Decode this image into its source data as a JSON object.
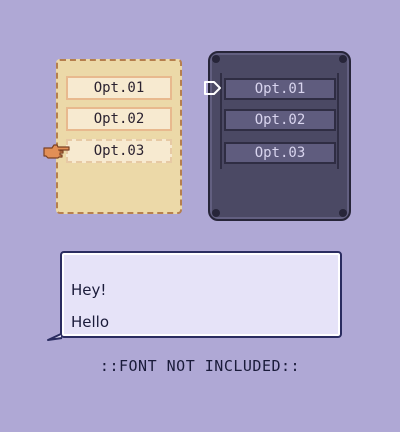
{
  "light_menu": {
    "options": [
      "Opt.01",
      "Opt.02",
      "Opt.03"
    ],
    "selected_index": 2,
    "colors": {
      "panel": "#ecd9a8",
      "border": "#b67f4d",
      "option_bg": "#f7ead0"
    },
    "cursor_icon": "pointing-hand-icon"
  },
  "dark_menu": {
    "options": [
      "Opt.01",
      "Opt.02",
      "Opt.03"
    ],
    "selected_index": 0,
    "colors": {
      "panel": "#4b4964",
      "border": "#272539",
      "option_bg": "#5f5c7e"
    },
    "cursor_icon": "outline-arrow-icon"
  },
  "dialog": {
    "lines": [
      "Hey!",
      "Hello"
    ],
    "colors": {
      "bg": "#e6e3f8",
      "border": "#2a2c60"
    }
  },
  "caption": "::FONT NOT INCLUDED::",
  "colors": {
    "background": "#afa8d5"
  }
}
